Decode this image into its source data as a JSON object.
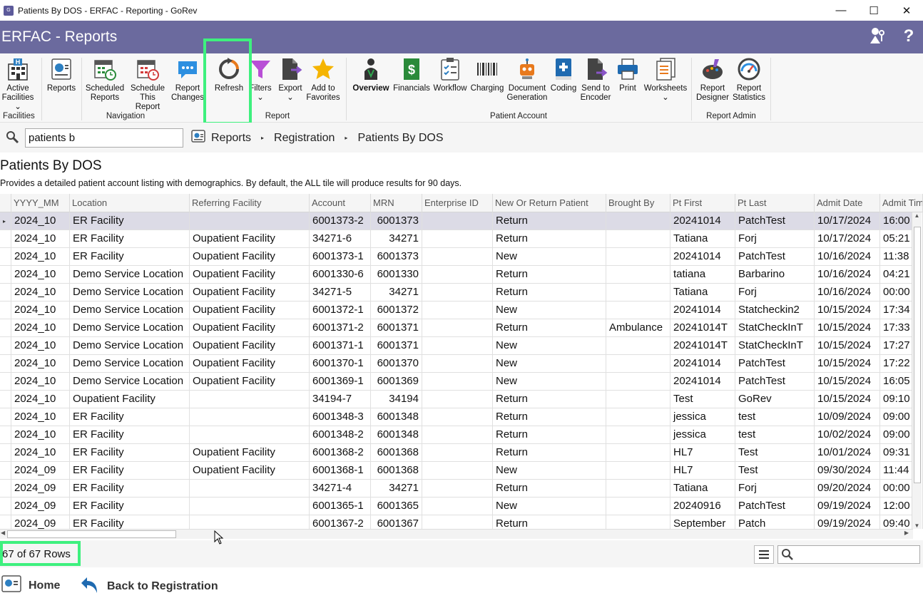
{
  "window": {
    "title": "Patients By DOS - ERFAC - Reporting - GoRev",
    "app_icon_text": "GoRev",
    "minimize": "—",
    "maximize": "☐",
    "close": "✕"
  },
  "header": {
    "title": "ERFAC - Reports",
    "user_icon": "user-key-icon",
    "help_label": "?"
  },
  "ribbon": {
    "groups": {
      "facilities": "Facilities",
      "navigation": "Navigation",
      "report": "Report",
      "patient_account": "Patient Account",
      "report_admin": "Report Admin"
    },
    "buttons": {
      "active_facilities": "Active\nFacilities ⌄",
      "reports": "Reports",
      "scheduled_reports": "Scheduled\nReports",
      "schedule_this_report": "Schedule\nThis Report",
      "report_changes": "Report\nChanges",
      "refresh": "Refresh",
      "filters": "Filters\n⌄",
      "export": "Export\n⌄",
      "add_to_favorites": "Add to\nFavorites",
      "overview": "Overview",
      "financials": "Financials",
      "workflow": "Workflow",
      "charging": "Charging",
      "document_generation": "Document\nGeneration",
      "coding": "Coding",
      "send_to_encoder": "Send to\nEncoder",
      "print": "Print",
      "worksheets": "Worksheets\n⌄",
      "report_designer": "Report\nDesigner",
      "report_statistics": "Report\nStatistics"
    }
  },
  "search": {
    "value": "patients b"
  },
  "breadcrumb": [
    "Reports",
    "Registration",
    "Patients By DOS"
  ],
  "page": {
    "title": "Patients By DOS",
    "description": "Provides a detailed patient account listing with demographics. By default, the ALL tile will produce results for 90 days."
  },
  "table": {
    "columns": [
      "YYYY_MM",
      "Location",
      "Referring Facility",
      "Account",
      "MRN",
      "Enterprise ID",
      "New Or Return Patient",
      "Brought By",
      "Pt First",
      "Pt Last",
      "Admit Date",
      "Admit Time"
    ],
    "rows": [
      [
        "2024_10",
        "ER Facility",
        "",
        "6001373-2",
        "6001373",
        "",
        "Return",
        "",
        "20241014",
        "PatchTest",
        "10/17/2024",
        "16:00"
      ],
      [
        "2024_10",
        "ER Facility",
        "Oupatient Facility",
        "34271-6",
        "34271",
        "",
        "Return",
        "",
        "Tatiana",
        "Forj",
        "10/17/2024",
        "05:21"
      ],
      [
        "2024_10",
        "ER Facility",
        "Oupatient Facility",
        "6001373-1",
        "6001373",
        "",
        "New",
        "",
        "20241014",
        "PatchTest",
        "10/16/2024",
        "11:38"
      ],
      [
        "2024_10",
        "Demo Service Location",
        "Oupatient Facility",
        "6001330-6",
        "6001330",
        "",
        "Return",
        "",
        "tatiana",
        "Barbarino",
        "10/16/2024",
        "04:21"
      ],
      [
        "2024_10",
        "Demo Service Location",
        "Oupatient Facility",
        "34271-5",
        "34271",
        "",
        "Return",
        "",
        "Tatiana",
        "Forj",
        "10/16/2024",
        "00:00"
      ],
      [
        "2024_10",
        "Demo Service Location",
        "Oupatient Facility",
        "6001372-1",
        "6001372",
        "",
        "New",
        "",
        "20241014",
        "Statcheckin2",
        "10/15/2024",
        "17:34"
      ],
      [
        "2024_10",
        "Demo Service Location",
        "Oupatient Facility",
        "6001371-2",
        "6001371",
        "",
        "Return",
        "Ambulance",
        "20241014T",
        "StatCheckInT",
        "10/15/2024",
        "17:33"
      ],
      [
        "2024_10",
        "Demo Service Location",
        "Oupatient Facility",
        "6001371-1",
        "6001371",
        "",
        "New",
        "",
        "20241014T",
        "StatCheckInT",
        "10/15/2024",
        "17:27"
      ],
      [
        "2024_10",
        "Demo Service Location",
        "Oupatient Facility",
        "6001370-1",
        "6001370",
        "",
        "New",
        "",
        "20241014",
        "PatchTest",
        "10/15/2024",
        "17:22"
      ],
      [
        "2024_10",
        "Demo Service Location",
        "Oupatient Facility",
        "6001369-1",
        "6001369",
        "",
        "New",
        "",
        "20241014",
        "PatchTest",
        "10/15/2024",
        "16:05"
      ],
      [
        "2024_10",
        "Oupatient Facility",
        "",
        "34194-7",
        "34194",
        "",
        "Return",
        "",
        "Test",
        "GoRev",
        "10/15/2024",
        "09:10"
      ],
      [
        "2024_10",
        "ER Facility",
        "",
        "6001348-3",
        "6001348",
        "",
        "Return",
        "",
        "jessica",
        "test",
        "10/09/2024",
        "09:00"
      ],
      [
        "2024_10",
        "ER Facility",
        "",
        "6001348-2",
        "6001348",
        "",
        "Return",
        "",
        "jessica",
        "test",
        "10/02/2024",
        "09:00"
      ],
      [
        "2024_10",
        "ER Facility",
        "Oupatient Facility",
        "6001368-2",
        "6001368",
        "",
        "Return",
        "",
        "HL7",
        "Test",
        "10/01/2024",
        "09:31"
      ],
      [
        "2024_09",
        "ER Facility",
        "Oupatient Facility",
        "6001368-1",
        "6001368",
        "",
        "New",
        "",
        "HL7",
        "Test",
        "09/30/2024",
        "11:44"
      ],
      [
        "2024_09",
        "ER Facility",
        "",
        "34271-4",
        "34271",
        "",
        "Return",
        "",
        "Tatiana",
        "Forj",
        "09/20/2024",
        "00:00"
      ],
      [
        "2024_09",
        "ER Facility",
        "",
        "6001365-1",
        "6001365",
        "",
        "New",
        "",
        "20240916",
        "PatchTest",
        "09/19/2024",
        "12:00"
      ],
      [
        "2024_09",
        "ER Facility",
        "",
        "6001367-2",
        "6001367",
        "",
        "Return",
        "",
        "September",
        "Patch",
        "09/19/2024",
        "09:40"
      ]
    ]
  },
  "status": {
    "row_count": "67 of 67 Rows"
  },
  "footer": {
    "home": "Home",
    "back": "Back to Registration"
  },
  "colors": {
    "header_bg": "#6b6a9e",
    "highlight": "#3ef07e",
    "selected_row": "#dcdbe6",
    "accent_blue": "#2d7fc1"
  }
}
